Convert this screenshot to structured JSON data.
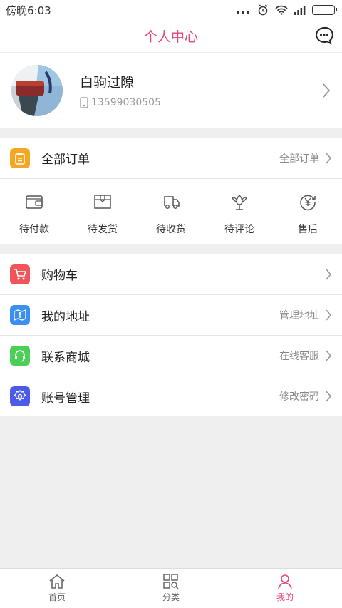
{
  "status_bar": {
    "time": "傍晚6:03",
    "dots": "..."
  },
  "header": {
    "title": "个人中心"
  },
  "profile": {
    "name": "白驹过隙",
    "phone": "13599030505"
  },
  "orders": {
    "label": "全部订单",
    "link": "全部订单",
    "items": [
      {
        "label": "待付款",
        "icon": "wallet-icon"
      },
      {
        "label": "待发货",
        "icon": "package-icon"
      },
      {
        "label": "待收货",
        "icon": "truck-icon"
      },
      {
        "label": "待评论",
        "icon": "flower-icon"
      },
      {
        "label": "售后",
        "icon": "yuan-refund-icon"
      }
    ]
  },
  "menu": [
    {
      "label": "购物车",
      "right": "",
      "color": "#f2545b",
      "icon": "cart-icon"
    },
    {
      "label": "我的地址",
      "right": "管理地址",
      "color": "#3a8ff0",
      "icon": "map-icon"
    },
    {
      "label": "联系商城",
      "right": "在线客服",
      "color": "#4ccf56",
      "icon": "headset-icon"
    },
    {
      "label": "账号管理",
      "right": "修改密码",
      "color": "#4b5be8",
      "icon": "gear-icon"
    }
  ],
  "colors": {
    "accent": "#e8457a",
    "orders_icon": "#f5a623"
  },
  "tabbar": [
    {
      "label": "首页",
      "icon": "home-icon"
    },
    {
      "label": "分类",
      "icon": "category-icon"
    },
    {
      "label": "我的",
      "icon": "user-icon"
    }
  ]
}
